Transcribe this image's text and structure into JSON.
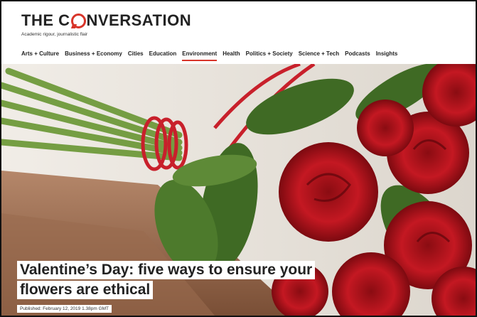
{
  "brand": {
    "logo_prefix": "THE C",
    "logo_suffix": "NVERSATION",
    "tagline": "Academic rigour, journalistic flair"
  },
  "nav": {
    "items": [
      {
        "label": "Arts + Culture"
      },
      {
        "label": "Business + Economy"
      },
      {
        "label": "Cities"
      },
      {
        "label": "Education"
      },
      {
        "label": "Environment",
        "active": true
      },
      {
        "label": "Health"
      },
      {
        "label": "Politics + Society"
      },
      {
        "label": "Science + Tech"
      },
      {
        "label": "Podcasts"
      },
      {
        "label": "Insights"
      }
    ]
  },
  "article": {
    "title_line1": "Valentine’s Day: five ways to ensure your",
    "title_line2": "flowers are ethical",
    "published": "Published: February 12, 2019 1.38pm GMT"
  },
  "colors": {
    "accent": "#d8352a",
    "rose": "#b3141c",
    "leaf": "#3f6a24"
  }
}
